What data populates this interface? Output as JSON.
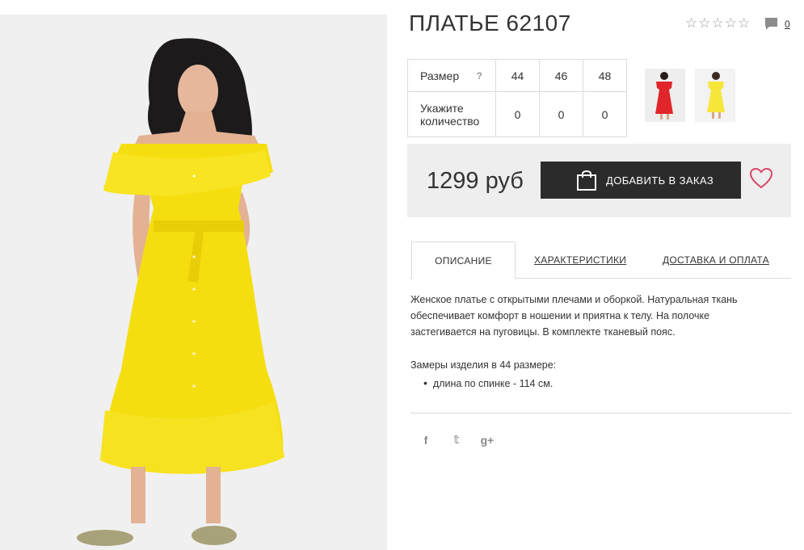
{
  "product": {
    "title": "ПЛАТЬЕ 62107",
    "rating_stars": [
      "☆",
      "☆",
      "☆",
      "☆",
      "☆"
    ],
    "comments_count": "0",
    "comments_icon": "speech-bubble-icon"
  },
  "sizes": {
    "size_label": "Размер",
    "help_mark": "?",
    "values": [
      "44",
      "46",
      "48"
    ],
    "qty_label": "Укажите количество",
    "quantities": [
      "0",
      "0",
      "0"
    ]
  },
  "thumbnails": [
    {
      "color": "red",
      "accent": "#e0262b"
    },
    {
      "color": "yellow",
      "accent": "#f7e63a"
    }
  ],
  "buy": {
    "price": "1299 руб",
    "order_button": "ДОБАВИТЬ В ЗАКАЗ",
    "cart_icon": "shopping-bag-icon",
    "wishlist_icon": "heart-icon",
    "heart_color": "#d9476a"
  },
  "tabs": [
    {
      "label": "ОПИСАНИЕ",
      "active": true
    },
    {
      "label": "ХАРАКТЕРИСТИКИ",
      "active": false
    },
    {
      "label": "ДОСТАВКА И ОПЛАТА",
      "active": false
    }
  ],
  "description": {
    "text": "Женское платье с открытыми плечами и оборкой. Натуральная ткань обеспечивает комфорт в ношении и приятна к телу. На полочке застегивается на пуговицы. В комплекте тканевый пояс.",
    "measure_title": "Замеры изделия в 44 размере:",
    "measures": [
      "длина по спинке - 114 см."
    ]
  },
  "social": [
    {
      "icon": "facebook-icon",
      "glyph": "f"
    },
    {
      "icon": "twitter-icon",
      "glyph": "𝕥"
    },
    {
      "icon": "google-plus-icon",
      "glyph": "g+"
    }
  ],
  "colors": {
    "dress_yellow": "#f5de10",
    "dark_button": "#2b2b2b",
    "price_box_bg": "#eeeeee"
  }
}
